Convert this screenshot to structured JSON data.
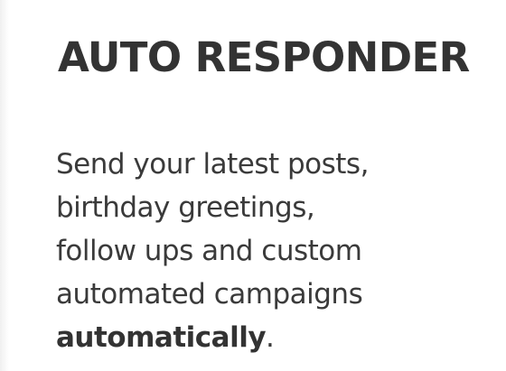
{
  "feature": {
    "title": "AUTO RESPONDER",
    "lines": [
      "Send your latest posts,",
      "birthday greetings,",
      "follow ups and custom",
      "automated campaigns"
    ],
    "emphasis": "automatically",
    "trailing": "."
  },
  "colors": {
    "title": "#333333",
    "text": "#3a3a3a",
    "background": "#ffffff"
  }
}
